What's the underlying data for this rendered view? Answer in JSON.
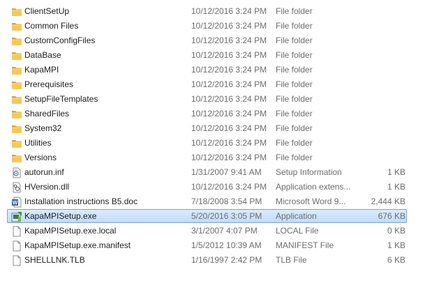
{
  "files": [
    {
      "name": "ClientSetUp",
      "date": "10/12/2016 3:24 PM",
      "type": "File folder",
      "size": "",
      "icon": "folder-icon"
    },
    {
      "name": "Common Files",
      "date": "10/12/2016 3:24 PM",
      "type": "File folder",
      "size": "",
      "icon": "folder-icon"
    },
    {
      "name": "CustomConfigFiles",
      "date": "10/12/2016 3:24 PM",
      "type": "File folder",
      "size": "",
      "icon": "folder-icon"
    },
    {
      "name": "DataBase",
      "date": "10/12/2016 3:24 PM",
      "type": "File folder",
      "size": "",
      "icon": "folder-icon"
    },
    {
      "name": "KapaMPI",
      "date": "10/12/2016 3:24 PM",
      "type": "File folder",
      "size": "",
      "icon": "folder-icon"
    },
    {
      "name": "Prerequisites",
      "date": "10/12/2016 3:24 PM",
      "type": "File folder",
      "size": "",
      "icon": "folder-icon"
    },
    {
      "name": "SetupFileTemplates",
      "date": "10/12/2016 3:24 PM",
      "type": "File folder",
      "size": "",
      "icon": "folder-icon"
    },
    {
      "name": "SharedFiles",
      "date": "10/12/2016 3:24 PM",
      "type": "File folder",
      "size": "",
      "icon": "folder-icon"
    },
    {
      "name": "System32",
      "date": "10/12/2016 3:24 PM",
      "type": "File folder",
      "size": "",
      "icon": "folder-icon"
    },
    {
      "name": "Utilities",
      "date": "10/12/2016 3:24 PM",
      "type": "File folder",
      "size": "",
      "icon": "folder-icon"
    },
    {
      "name": "Versions",
      "date": "10/12/2016 3:24 PM",
      "type": "File folder",
      "size": "",
      "icon": "folder-icon"
    },
    {
      "name": "autorun.inf",
      "date": "1/31/2007 9:41 AM",
      "type": "Setup Information",
      "size": "1 KB",
      "icon": "setup-info-icon"
    },
    {
      "name": "HVersion.dll",
      "date": "10/12/2016 3:24 PM",
      "type": "Application extens...",
      "size": "1 KB",
      "icon": "dll-icon"
    },
    {
      "name": "Installation instructions B5.doc",
      "date": "7/18/2008 3:54 PM",
      "type": "Microsoft Word 9...",
      "size": "2,444 KB",
      "icon": "word-doc-icon"
    },
    {
      "name": "KapaMPISetup.exe",
      "date": "5/20/2016 3:05 PM",
      "type": "Application",
      "size": "676 KB",
      "icon": "setup-exe-icon",
      "selected": true
    },
    {
      "name": "KapaMPISetup.exe.local",
      "date": "3/1/2007 4:07 PM",
      "type": "LOCAL File",
      "size": "0 KB",
      "icon": "blank-file-icon"
    },
    {
      "name": "KapaMPISetup.exe.manifest",
      "date": "1/5/2012 10:39 AM",
      "type": "MANIFEST File",
      "size": "1 KB",
      "icon": "blank-file-icon"
    },
    {
      "name": "SHELLLNK.TLB",
      "date": "1/16/1997 2:42 PM",
      "type": "TLB File",
      "size": "6 KB",
      "icon": "blank-file-icon"
    }
  ],
  "colors": {
    "folder": "#e8b84a",
    "selection_border": "#7da2ce",
    "selection_fill": "#cde3fc",
    "secondary_text": "#6d6d6d"
  }
}
